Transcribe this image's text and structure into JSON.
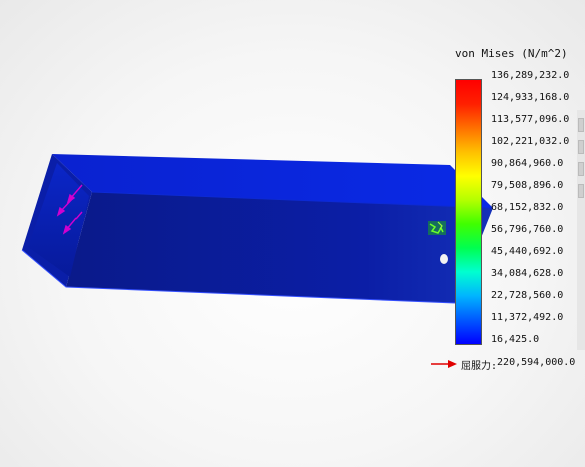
{
  "legend": {
    "title": "von Mises (N/m^2)",
    "colors": [
      "#0000ff",
      "#0058ff",
      "#00b4ff",
      "#00ffd0",
      "#00ff50",
      "#40ff00",
      "#b4ff00",
      "#ffff00",
      "#ffc000",
      "#ff7000",
      "#ff2000",
      "#ff0000"
    ],
    "ticks": [
      "136,289,232.0",
      "124,933,168.0",
      "113,577,096.0",
      "102,221,032.0",
      "90,864,960.0",
      "79,508,896.0",
      "68,152,832.0",
      "56,796,760.0",
      "45,440,692.0",
      "34,084,628.0",
      "22,728,560.0",
      "11,372,492.0",
      "16,425.0"
    ],
    "yield_label": "屈服力:",
    "yield_value": "220,594,000.0",
    "yield_arrow_color": "#e00000"
  },
  "model": {
    "top_face_color": "#0a24d8",
    "front_face_color": "#061a9c",
    "end_face_color": "#0b1fb0",
    "load_arrow_color": "#d000d0",
    "hotspot_color": "#39d41a"
  }
}
